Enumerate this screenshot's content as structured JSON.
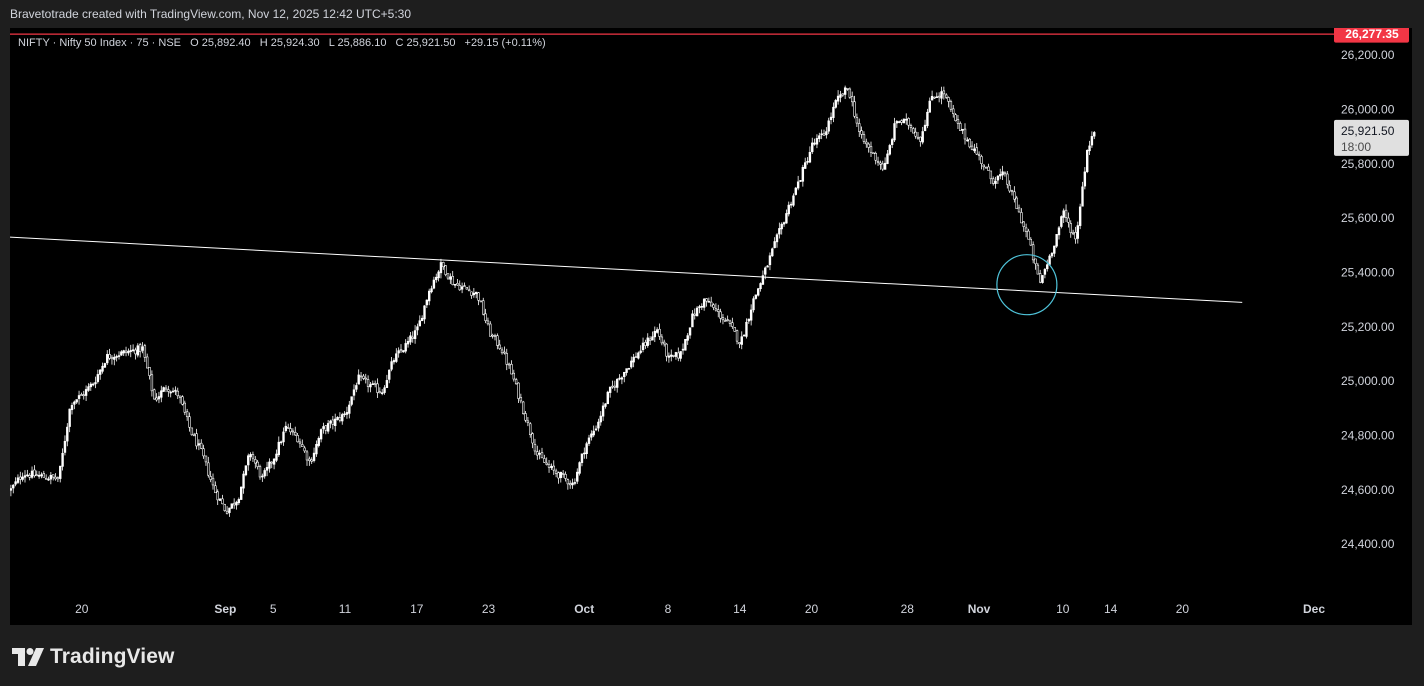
{
  "caption": "Bravetotrade created with TradingView.com, Nov 12, 2025 12:42 UTC+5:30",
  "symbol_info": {
    "name": "NIFTY · Nifty 50 Index · 75 · NSE",
    "open_label": "O",
    "open": "25,892.40",
    "high_label": "H",
    "high": "25,924.30",
    "low_label": "L",
    "low": "25,886.10",
    "close_label": "C",
    "close": "25,921.50",
    "change": "+29.15 (+0.11%)"
  },
  "price_tags": {
    "alert_level": "26,277.35",
    "last_price": "25,921.50",
    "countdown": "18:00"
  },
  "footer": {
    "brand": "TradingView",
    "logo_icon": "tradingview-logo-icon"
  },
  "colors": {
    "background": "#000000",
    "frame": "#1e1e1e",
    "candle": "#ffffff",
    "alert_line": "#f23645",
    "trendline": "#ffffff",
    "highlight_circle": "#4fc3d9"
  },
  "chart_data": {
    "type": "candlestick",
    "interval": "75 min",
    "price_axis": {
      "range": [
        24220,
        26300
      ],
      "ticks": [
        {
          "value": 24400,
          "label": "24,400.00"
        },
        {
          "value": 24600,
          "label": "24,600.00"
        },
        {
          "value": 24800,
          "label": "24,800.00"
        },
        {
          "value": 25000,
          "label": "25,000.00"
        },
        {
          "value": 25200,
          "label": "25,200.00"
        },
        {
          "value": 25400,
          "label": "25,400.00"
        },
        {
          "value": 25600,
          "label": "25,600.00"
        },
        {
          "value": 25800,
          "label": "25,800.00"
        },
        {
          "value": 26000,
          "label": "26,000.00"
        },
        {
          "value": 26200,
          "label": "26,200.00"
        }
      ]
    },
    "time_axis": {
      "range": [
        "Aug 14, 2025",
        "Dec 1, 2025"
      ],
      "ticks": [
        {
          "date": "Aug 20",
          "label": "20",
          "bold": false
        },
        {
          "date": "Sep 1",
          "label": "Sep",
          "bold": true
        },
        {
          "date": "Sep 5",
          "label": "5",
          "bold": false
        },
        {
          "date": "Sep 11",
          "label": "11",
          "bold": false
        },
        {
          "date": "Sep 17",
          "label": "17",
          "bold": false
        },
        {
          "date": "Sep 23",
          "label": "23",
          "bold": false
        },
        {
          "date": "Oct 1",
          "label": "Oct",
          "bold": true
        },
        {
          "date": "Oct 8",
          "label": "8",
          "bold": false
        },
        {
          "date": "Oct 14",
          "label": "14",
          "bold": false
        },
        {
          "date": "Oct 20",
          "label": "20",
          "bold": false
        },
        {
          "date": "Oct 28",
          "label": "28",
          "bold": false
        },
        {
          "date": "Nov 3",
          "label": "Nov",
          "bold": true
        },
        {
          "date": "Nov 10",
          "label": "10",
          "bold": false
        },
        {
          "date": "Nov 14",
          "label": "14",
          "bold": false
        },
        {
          "date": "Nov 20",
          "label": "20",
          "bold": false
        },
        {
          "date": "Dec 1",
          "label": "Dec",
          "bold": true
        }
      ]
    },
    "alert_level": 26277.35,
    "last_close": 25921.5,
    "trendline": {
      "start": [
        "Aug 14, 2025",
        25530
      ],
      "end": [
        "Nov 25, 2025",
        25290
      ]
    },
    "highlight": {
      "date": "Nov 7, 2025",
      "price": 25355
    },
    "close_path": [
      [
        "Aug 14",
        24600
      ],
      [
        "Aug 15",
        24660
      ],
      [
        "Aug 18",
        24640
      ],
      [
        "Aug 19",
        24920
      ],
      [
        "Aug 20",
        24950
      ],
      [
        "Aug 21",
        25000
      ],
      [
        "Aug 22",
        25090
      ],
      [
        "Aug 25",
        25120
      ],
      [
        "Aug 26",
        24930
      ],
      [
        "Aug 27",
        24980
      ],
      [
        "Aug 28",
        24950
      ],
      [
        "Aug 29",
        24820
      ],
      [
        "Aug 30",
        24730
      ],
      [
        "Aug 31",
        24600
      ],
      [
        "Sep 1",
        24520
      ],
      [
        "Sep 2",
        24570
      ],
      [
        "Sep 3",
        24740
      ],
      [
        "Sep 4",
        24640
      ],
      [
        "Sep 5",
        24720
      ],
      [
        "Sep 6",
        24830
      ],
      [
        "Sep 7",
        24790
      ],
      [
        "Sep 8",
        24700
      ],
      [
        "Sep 9",
        24820
      ],
      [
        "Sep 11",
        24880
      ],
      [
        "Sep 12",
        25010
      ],
      [
        "Sep 14",
        24960
      ],
      [
        "Sep 15",
        25080
      ],
      [
        "Sep 16",
        25130
      ],
      [
        "Sep 17",
        25190
      ],
      [
        "Sep 18",
        25340
      ],
      [
        "Sep 19",
        25430
      ],
      [
        "Sep 20",
        25360
      ],
      [
        "Sep 22",
        25320
      ],
      [
        "Sep 23",
        25180
      ],
      [
        "Sep 24",
        25120
      ],
      [
        "Sep 25",
        25010
      ],
      [
        "Sep 26",
        24870
      ],
      [
        "Sep 27",
        24730
      ],
      [
        "Sep 28",
        24680
      ],
      [
        "Sep 29",
        24650
      ],
      [
        "Sep 30",
        24620
      ],
      [
        "Oct 1",
        24760
      ],
      [
        "Oct 2",
        24840
      ],
      [
        "Oct 3",
        24960
      ],
      [
        "Oct 5",
        25080
      ],
      [
        "Oct 7",
        25190
      ],
      [
        "Oct 8",
        25080
      ],
      [
        "Oct 9",
        25100
      ],
      [
        "Oct 10",
        25240
      ],
      [
        "Oct 11",
        25300
      ],
      [
        "Oct 13",
        25210
      ],
      [
        "Oct 14",
        25140
      ],
      [
        "Oct 15",
        25290
      ],
      [
        "Oct 16",
        25400
      ],
      [
        "Oct 17",
        25520
      ],
      [
        "Oct 18",
        25640
      ],
      [
        "Oct 19",
        25750
      ],
      [
        "Oct 20",
        25870
      ],
      [
        "Oct 21",
        25910
      ],
      [
        "Oct 22",
        26030
      ],
      [
        "Oct 23",
        26080
      ],
      [
        "Oct 24",
        25900
      ],
      [
        "Oct 26",
        25780
      ],
      [
        "Oct 27",
        25960
      ],
      [
        "Oct 28",
        25950
      ],
      [
        "Oct 29",
        25890
      ],
      [
        "Oct 30",
        26050
      ],
      [
        "Oct 31",
        26060
      ],
      [
        "Nov 1",
        25950
      ],
      [
        "Nov 3",
        25820
      ],
      [
        "Nov 4",
        25740
      ],
      [
        "Nov 5",
        25760
      ],
      [
        "Nov 6",
        25650
      ],
      [
        "Nov 7",
        25530
      ],
      [
        "Nov 8",
        25360
      ],
      [
        "Nov 9",
        25480
      ],
      [
        "Nov 10",
        25620
      ],
      [
        "Nov 11",
        25520
      ],
      [
        "Nov 12",
        25860
      ],
      [
        "Nov 12.6",
        25921.5
      ]
    ]
  }
}
